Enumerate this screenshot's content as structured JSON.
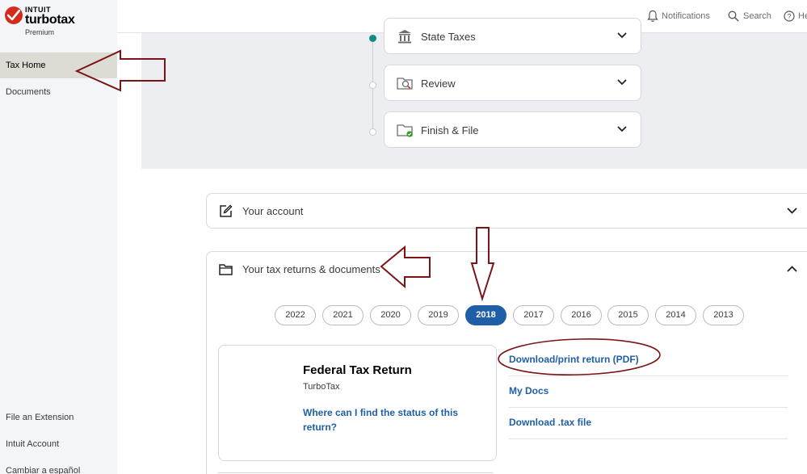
{
  "brand": {
    "company": "INTUIT",
    "product": "turbotax",
    "edition": "Premium",
    "accent_color": "#d52b1e"
  },
  "sidebar": {
    "items": [
      {
        "label": "Tax Home",
        "active": true
      },
      {
        "label": "Documents",
        "active": false
      }
    ],
    "bottom_items": [
      {
        "label": "File an Extension"
      },
      {
        "label": "Intuit Account"
      },
      {
        "label": "Cambiar a español"
      }
    ]
  },
  "topbar": {
    "notifications": {
      "label": "Notifications",
      "icon": "bell-icon"
    },
    "search": {
      "label": "Search",
      "icon": "search-icon"
    },
    "help": {
      "label": "He",
      "icon": "help-icon"
    }
  },
  "progress": {
    "steps": [
      {
        "label": "State Taxes",
        "icon": "state-building-icon",
        "status": "current"
      },
      {
        "label": "Review",
        "icon": "review-magnifier-icon",
        "status": "pending"
      },
      {
        "label": "Finish & File",
        "icon": "finish-folder-icon",
        "status": "pending"
      }
    ],
    "complete_color": "#108d7f"
  },
  "account_card": {
    "title": "Your account",
    "icon": "edit-icon",
    "expanded": false
  },
  "returns_card": {
    "title": "Your tax returns & documents",
    "icon": "folder-icon",
    "expanded": true,
    "years": [
      "2022",
      "2021",
      "2020",
      "2019",
      "2018",
      "2017",
      "2016",
      "2015",
      "2014",
      "2013"
    ],
    "selected_year": "2018",
    "federal": {
      "title": "Federal Tax Return",
      "subtitle": "TurboTax",
      "status_link": "Where can I find the status of this return?"
    },
    "links": [
      {
        "label": "Download/print return (PDF)"
      },
      {
        "label": "My Docs"
      },
      {
        "label": "Download .tax file"
      }
    ],
    "link_color": "#1f5fa8"
  },
  "annotations": {
    "arrow_color": "#7b1416"
  }
}
